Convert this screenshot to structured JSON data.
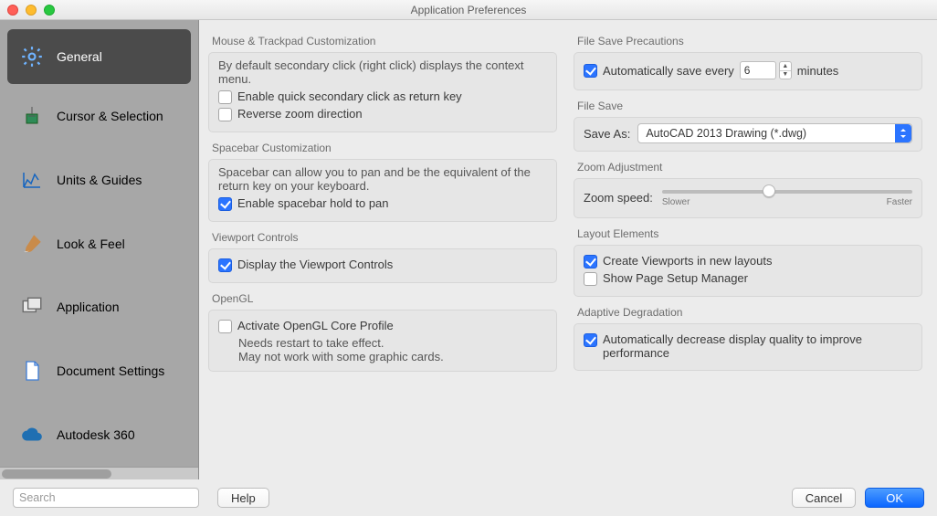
{
  "window": {
    "title": "Application Preferences"
  },
  "sidebar": {
    "items": [
      {
        "label": "General"
      },
      {
        "label": "Cursor & Selection"
      },
      {
        "label": "Units & Guides"
      },
      {
        "label": "Look & Feel"
      },
      {
        "label": "Application"
      },
      {
        "label": "Document Settings"
      },
      {
        "label": "Autodesk 360"
      }
    ],
    "search_placeholder": "Search"
  },
  "left": {
    "mouse_title": "Mouse & Trackpad Customization",
    "mouse_desc": "By default secondary click (right click) displays the context menu.",
    "quick_secondary": "Enable quick secondary click as return key",
    "reverse_zoom": "Reverse zoom direction",
    "spacebar_title": "Spacebar Customization",
    "spacebar_desc": "Spacebar can allow you to pan and be the equivalent of the return key on your keyboard.",
    "spacebar_pan": "Enable spacebar hold to pan",
    "viewport_title": "Viewport Controls",
    "viewport_display": "Display the Viewport Controls",
    "opengl_title": "OpenGL",
    "opengl_activate": "Activate OpenGL Core Profile",
    "opengl_note1": "Needs restart to take effect.",
    "opengl_note2": "May not work with some graphic cards."
  },
  "right": {
    "filesave_prec_title": "File Save Precautions",
    "autosave_label": "Automatically save every",
    "autosave_value": "6",
    "autosave_unit": "minutes",
    "filesave_title": "File Save",
    "saveas_label": "Save As:",
    "saveas_value": "AutoCAD 2013 Drawing (*.dwg)",
    "zoom_title": "Zoom Adjustment",
    "zoom_label": "Zoom speed:",
    "zoom_slow": "Slower",
    "zoom_fast": "Faster",
    "layout_title": "Layout Elements",
    "layout_create_vp": "Create Viewports in new layouts",
    "layout_page_setup": "Show Page Setup Manager",
    "adapt_title": "Adaptive Degradation",
    "adapt_label": "Automatically decrease display quality to improve performance"
  },
  "buttons": {
    "help": "Help",
    "cancel": "Cancel",
    "ok": "OK"
  },
  "colors": {
    "accent": "#2b74ff"
  }
}
